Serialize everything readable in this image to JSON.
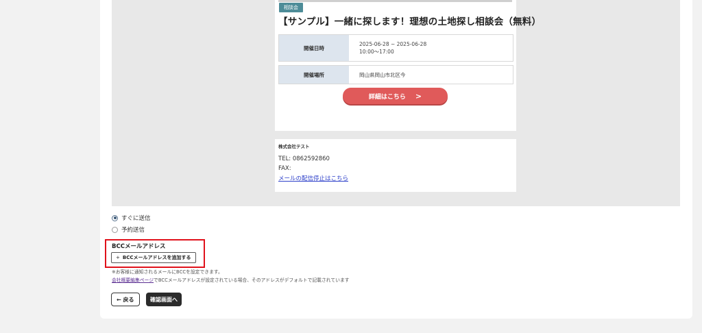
{
  "email_preview": {
    "tag": "相談会",
    "title": "【サンプル】一緒に探します！理想の土地探し相談会（無料）",
    "rows": [
      {
        "label": "開催日時",
        "value_line1": "2025-06-28 ~ 2025-06-28",
        "value_line2": "10:00〜17:00"
      },
      {
        "label": "開催場所",
        "value_line1": "岡山県岡山市北区今",
        "value_line2": ""
      }
    ],
    "detail_button": "詳細はこちら",
    "footer": {
      "company": "株式会社テスト",
      "tel": "TEL: 0862592860",
      "fax": "FAX:",
      "unsubscribe": "メールの配信停止はこちら"
    }
  },
  "send_options": {
    "immediate": "すぐに送信",
    "scheduled": "予約送信",
    "selected": "immediate"
  },
  "bcc": {
    "label": "BCCメールアドレス",
    "add_button": "BCCメールアドレスを追加する",
    "note1": "※お客様に通知されるメールにBCCを設定できます。",
    "note2_link": "会社概要編集ページ",
    "note2_text": "でBCCメールアドレスが設定されている場合、そのアドレスがデフォルトで記載されています"
  },
  "actions": {
    "back": "← 戻る",
    "confirm": "確認画面へ"
  },
  "colors": {
    "accent_button": "#e05a5a",
    "tag": "#4d8c98",
    "highlight_box": "#e0101a",
    "confirm_button": "#2b2b2b"
  }
}
